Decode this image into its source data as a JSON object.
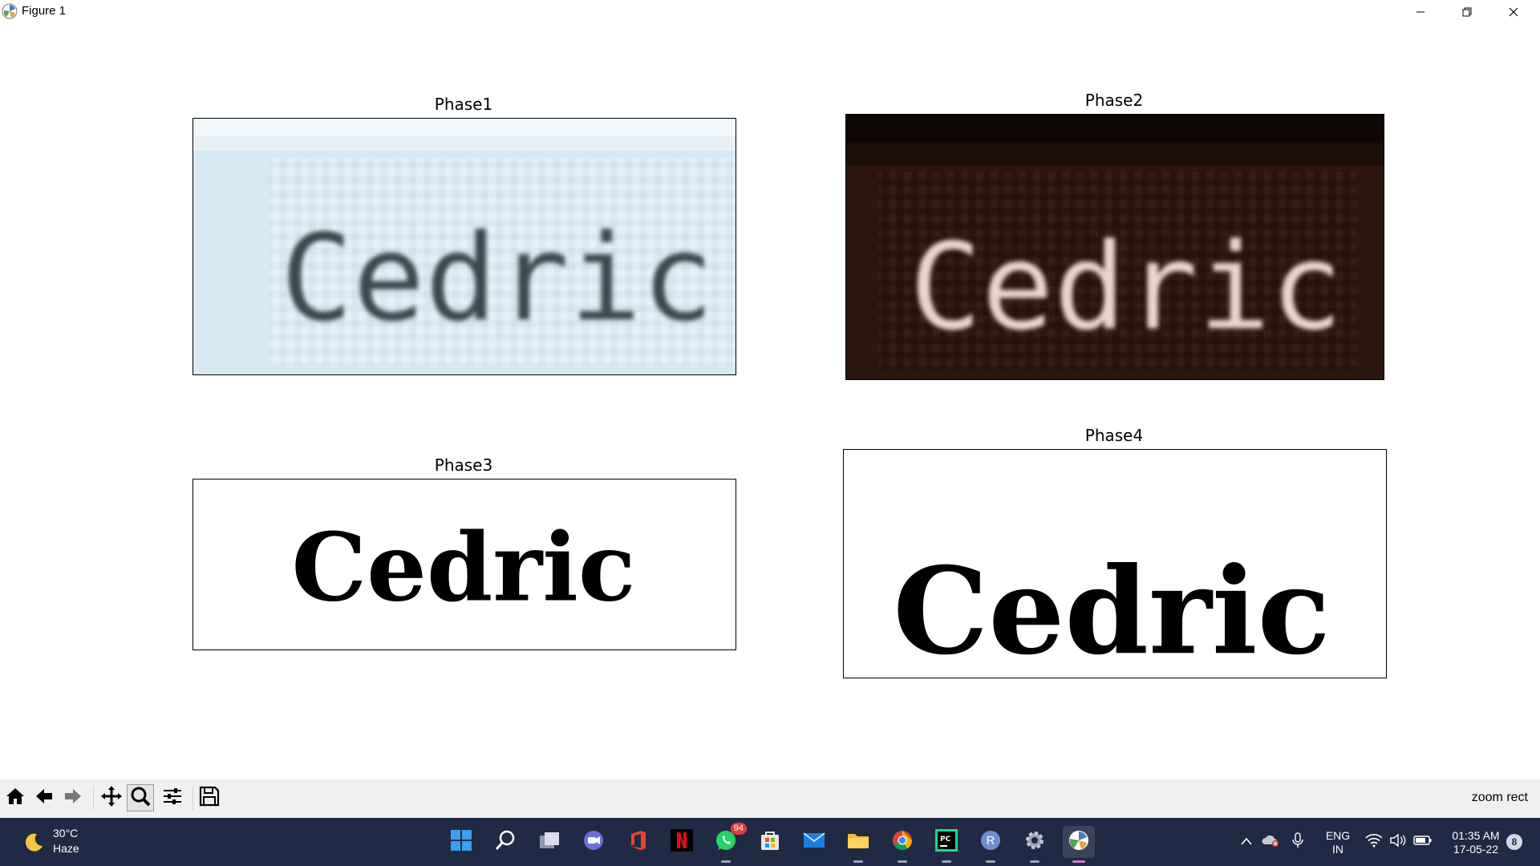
{
  "window": {
    "title": "Figure 1",
    "controls": [
      "minimize",
      "restore",
      "close"
    ]
  },
  "figure": {
    "subplots": [
      {
        "title": "Phase1",
        "image_word": "Cedric",
        "style": "blurry dark text on light blue background"
      },
      {
        "title": "Phase2",
        "image_word": "Cedric",
        "style": "inverted light text on dark brown background"
      },
      {
        "title": "Phase3",
        "image_word": "Cedric",
        "style": "binary black text on white"
      },
      {
        "title": "Phase4",
        "image_word": "Cedric",
        "style": "binary black text on white, padded"
      }
    ]
  },
  "toolbar": {
    "buttons": [
      "home-icon",
      "back-icon",
      "forward-icon",
      "pan-icon",
      "zoom-icon",
      "configure-subplots-icon",
      "save-icon"
    ],
    "active_button": "zoom-icon",
    "status_message": "zoom rect"
  },
  "taskbar": {
    "weather": {
      "temperature": "30°C",
      "condition": "Haze"
    },
    "apps": [
      "start",
      "search",
      "task-view",
      "teams",
      "office",
      "netflix",
      "whatsapp",
      "microsoft-store",
      "mail",
      "file-explorer",
      "chrome",
      "pycharm",
      "r",
      "settings",
      "matplotlib-figure"
    ],
    "whatsapp_badge": "94",
    "language": {
      "line1": "ENG",
      "line2": "IN"
    },
    "clock": {
      "time": "01:35 AM",
      "date": "17-05-22"
    },
    "notification_count": "8",
    "colors": {
      "background": "#202a44",
      "active_indicator": "#d27cd0"
    }
  }
}
